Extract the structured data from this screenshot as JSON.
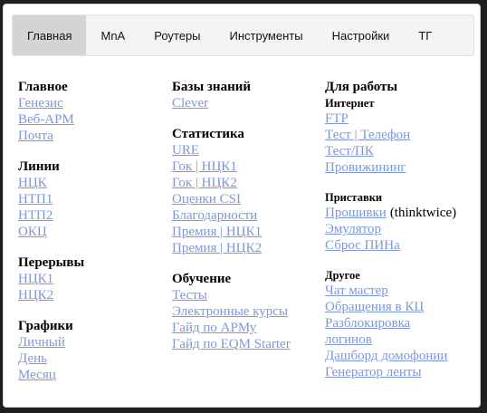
{
  "tabs": [
    "Главная",
    "MnA",
    "Роутеры",
    "Инструменты",
    "Настройки",
    "ТГ"
  ],
  "col1": {
    "glavnoe": {
      "title": "Главное",
      "links": [
        "Генезис",
        "Веб-АРМ",
        "Почта"
      ]
    },
    "linii": {
      "title": "Линии",
      "links": [
        "НЦК",
        "НТП1",
        "НТП2",
        "ОКЦ"
      ]
    },
    "pereryvy": {
      "title": "Перерывы",
      "links": [
        "НЦК1",
        "НЦК2"
      ]
    },
    "grafiki": {
      "title": "Графики",
      "links": [
        "Личный",
        "День",
        "Месяц"
      ]
    }
  },
  "col2": {
    "bazy": {
      "title": "Базы знаний",
      "links": [
        "Clever"
      ]
    },
    "statistika": {
      "title": "Статистика",
      "links": [
        "URE",
        "Гок | НЦК1",
        "Гок | НЦК2",
        "Оценки CSI",
        "Благодарности",
        "Премия | НЦК1",
        "Премия | НЦК2"
      ]
    },
    "obuchenie": {
      "title": "Обучение",
      "links": [
        "Тесты",
        "Электронные курсы",
        "Гайд по АРМу",
        "Гайд по EQM Starter"
      ]
    }
  },
  "col3": {
    "title": "Для работы",
    "internet": {
      "subtitle": "Интернет",
      "links": [
        "FTP",
        "Тест | Телефон",
        "Тест/ПК",
        "Провижининг"
      ]
    },
    "pristavki": {
      "subtitle": "Приставки",
      "firmware_link": "Прошивки",
      "firmware_note": "(thinktwice)",
      "links": [
        "Эмулятор",
        "Сброс ПИНа"
      ]
    },
    "drugoe": {
      "subtitle": "Другое",
      "links": [
        "Чат мастер",
        "Обращения в КЦ",
        "Разблокировка",
        "логинов",
        "Дашборд домофонии",
        "Генератор ленты"
      ]
    }
  }
}
